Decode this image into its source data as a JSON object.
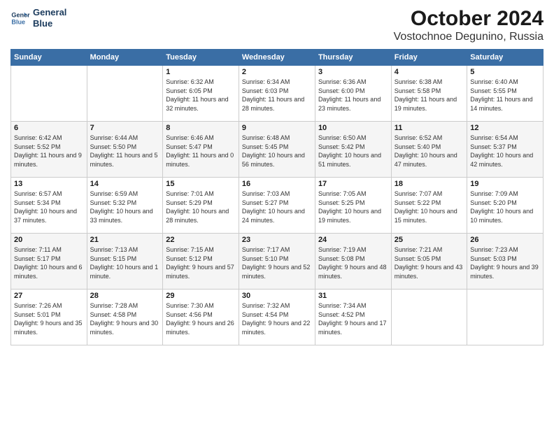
{
  "header": {
    "logo": {
      "line1": "General",
      "line2": "Blue"
    },
    "month": "October 2024",
    "location": "Vostochnoe Degunino, Russia"
  },
  "weekdays": [
    "Sunday",
    "Monday",
    "Tuesday",
    "Wednesday",
    "Thursday",
    "Friday",
    "Saturday"
  ],
  "weeks": [
    [
      {
        "day": "",
        "info": ""
      },
      {
        "day": "",
        "info": ""
      },
      {
        "day": "1",
        "info": "Sunrise: 6:32 AM\nSunset: 6:05 PM\nDaylight: 11 hours and 32 minutes."
      },
      {
        "day": "2",
        "info": "Sunrise: 6:34 AM\nSunset: 6:03 PM\nDaylight: 11 hours and 28 minutes."
      },
      {
        "day": "3",
        "info": "Sunrise: 6:36 AM\nSunset: 6:00 PM\nDaylight: 11 hours and 23 minutes."
      },
      {
        "day": "4",
        "info": "Sunrise: 6:38 AM\nSunset: 5:58 PM\nDaylight: 11 hours and 19 minutes."
      },
      {
        "day": "5",
        "info": "Sunrise: 6:40 AM\nSunset: 5:55 PM\nDaylight: 11 hours and 14 minutes."
      }
    ],
    [
      {
        "day": "6",
        "info": "Sunrise: 6:42 AM\nSunset: 5:52 PM\nDaylight: 11 hours and 9 minutes."
      },
      {
        "day": "7",
        "info": "Sunrise: 6:44 AM\nSunset: 5:50 PM\nDaylight: 11 hours and 5 minutes."
      },
      {
        "day": "8",
        "info": "Sunrise: 6:46 AM\nSunset: 5:47 PM\nDaylight: 11 hours and 0 minutes."
      },
      {
        "day": "9",
        "info": "Sunrise: 6:48 AM\nSunset: 5:45 PM\nDaylight: 10 hours and 56 minutes."
      },
      {
        "day": "10",
        "info": "Sunrise: 6:50 AM\nSunset: 5:42 PM\nDaylight: 10 hours and 51 minutes."
      },
      {
        "day": "11",
        "info": "Sunrise: 6:52 AM\nSunset: 5:40 PM\nDaylight: 10 hours and 47 minutes."
      },
      {
        "day": "12",
        "info": "Sunrise: 6:54 AM\nSunset: 5:37 PM\nDaylight: 10 hours and 42 minutes."
      }
    ],
    [
      {
        "day": "13",
        "info": "Sunrise: 6:57 AM\nSunset: 5:34 PM\nDaylight: 10 hours and 37 minutes."
      },
      {
        "day": "14",
        "info": "Sunrise: 6:59 AM\nSunset: 5:32 PM\nDaylight: 10 hours and 33 minutes."
      },
      {
        "day": "15",
        "info": "Sunrise: 7:01 AM\nSunset: 5:29 PM\nDaylight: 10 hours and 28 minutes."
      },
      {
        "day": "16",
        "info": "Sunrise: 7:03 AM\nSunset: 5:27 PM\nDaylight: 10 hours and 24 minutes."
      },
      {
        "day": "17",
        "info": "Sunrise: 7:05 AM\nSunset: 5:25 PM\nDaylight: 10 hours and 19 minutes."
      },
      {
        "day": "18",
        "info": "Sunrise: 7:07 AM\nSunset: 5:22 PM\nDaylight: 10 hours and 15 minutes."
      },
      {
        "day": "19",
        "info": "Sunrise: 7:09 AM\nSunset: 5:20 PM\nDaylight: 10 hours and 10 minutes."
      }
    ],
    [
      {
        "day": "20",
        "info": "Sunrise: 7:11 AM\nSunset: 5:17 PM\nDaylight: 10 hours and 6 minutes."
      },
      {
        "day": "21",
        "info": "Sunrise: 7:13 AM\nSunset: 5:15 PM\nDaylight: 10 hours and 1 minute."
      },
      {
        "day": "22",
        "info": "Sunrise: 7:15 AM\nSunset: 5:12 PM\nDaylight: 9 hours and 57 minutes."
      },
      {
        "day": "23",
        "info": "Sunrise: 7:17 AM\nSunset: 5:10 PM\nDaylight: 9 hours and 52 minutes."
      },
      {
        "day": "24",
        "info": "Sunrise: 7:19 AM\nSunset: 5:08 PM\nDaylight: 9 hours and 48 minutes."
      },
      {
        "day": "25",
        "info": "Sunrise: 7:21 AM\nSunset: 5:05 PM\nDaylight: 9 hours and 43 minutes."
      },
      {
        "day": "26",
        "info": "Sunrise: 7:23 AM\nSunset: 5:03 PM\nDaylight: 9 hours and 39 minutes."
      }
    ],
    [
      {
        "day": "27",
        "info": "Sunrise: 7:26 AM\nSunset: 5:01 PM\nDaylight: 9 hours and 35 minutes."
      },
      {
        "day": "28",
        "info": "Sunrise: 7:28 AM\nSunset: 4:58 PM\nDaylight: 9 hours and 30 minutes."
      },
      {
        "day": "29",
        "info": "Sunrise: 7:30 AM\nSunset: 4:56 PM\nDaylight: 9 hours and 26 minutes."
      },
      {
        "day": "30",
        "info": "Sunrise: 7:32 AM\nSunset: 4:54 PM\nDaylight: 9 hours and 22 minutes."
      },
      {
        "day": "31",
        "info": "Sunrise: 7:34 AM\nSunset: 4:52 PM\nDaylight: 9 hours and 17 minutes."
      },
      {
        "day": "",
        "info": ""
      },
      {
        "day": "",
        "info": ""
      }
    ]
  ]
}
